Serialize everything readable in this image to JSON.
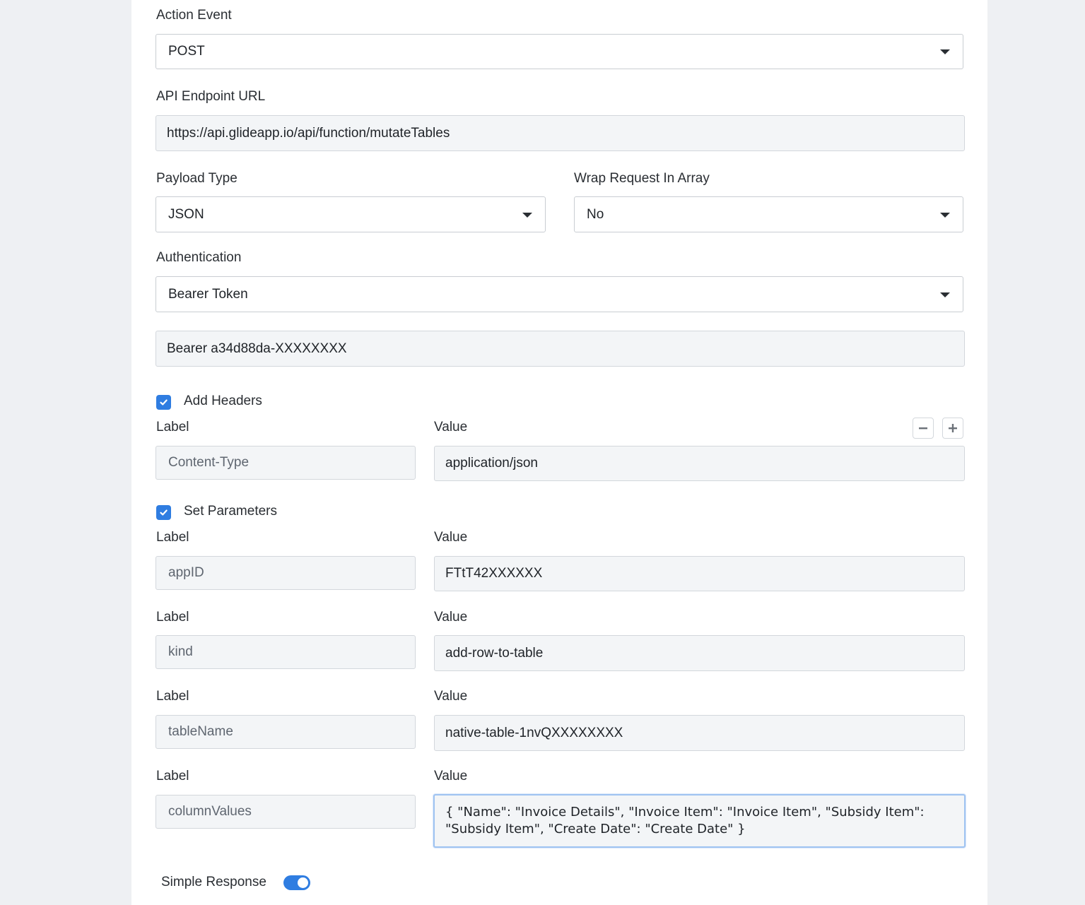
{
  "action_event": {
    "label": "Action Event",
    "value": "POST"
  },
  "endpoint": {
    "label": "API Endpoint URL",
    "value": "https://api.glideapp.io/api/function/mutateTables"
  },
  "payload_type": {
    "label": "Payload Type",
    "value": "JSON"
  },
  "wrap_request": {
    "label": "Wrap Request In Array",
    "value": "No"
  },
  "authentication": {
    "label": "Authentication",
    "value": "Bearer Token",
    "token": "Bearer a34d88da-XXXXXXXX"
  },
  "headers": {
    "checkbox_label": "Add Headers",
    "checked": true,
    "rows": [
      {
        "label_caption": "Label",
        "value_caption": "Value",
        "label": "Content-Type",
        "value": "application/json"
      }
    ]
  },
  "parameters": {
    "checkbox_label": "Set Parameters",
    "checked": true,
    "rows": [
      {
        "label_caption": "Label",
        "value_caption": "Value",
        "label": "appID",
        "value": "FTtT42XXXXXX"
      },
      {
        "label_caption": "Label",
        "value_caption": "Value",
        "label": "kind",
        "value": "add-row-to-table"
      },
      {
        "label_caption": "Label",
        "value_caption": "Value",
        "label": "tableName",
        "value": "native-table-1nvQXXXXXXXX"
      },
      {
        "label_caption": "Label",
        "value_caption": "Value",
        "label": "columnValues",
        "value": "{ \"Name\": \"Invoice Details\", \"Invoice Item\": \"Invoice Item\", \"Subsidy Item\": \"Subsidy Item\", \"Create Date\": \"Create Date\" }"
      }
    ]
  },
  "simple_response": {
    "label": "Simple Response",
    "enabled": true
  },
  "icons": [
    "chevron-down-icon",
    "check-icon",
    "minus-icon",
    "plus-icon"
  ],
  "colors": {
    "accent": "#2f7de1",
    "field_bg": "#f3f5f7",
    "page_bg": "#eef0f3"
  }
}
